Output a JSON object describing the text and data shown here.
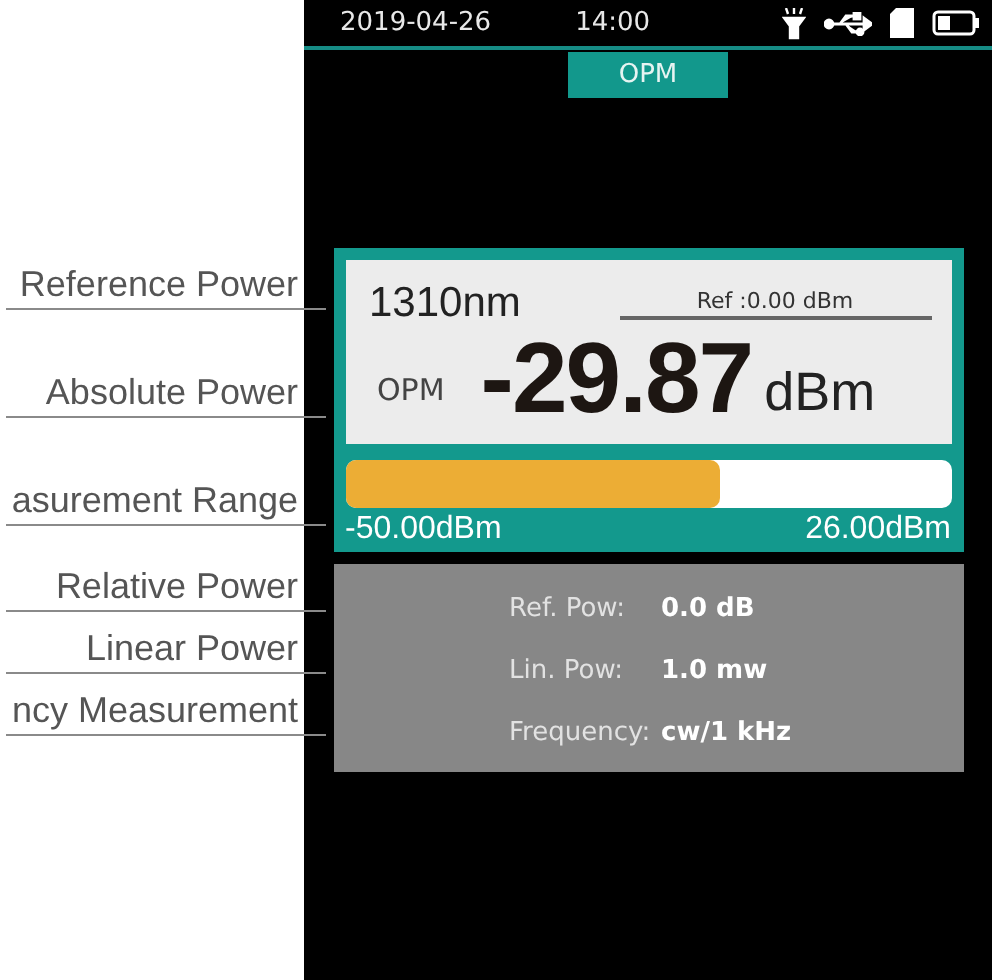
{
  "callouts": [
    {
      "label": "Reference Power"
    },
    {
      "label": "Absolute Power"
    },
    {
      "label": "asurement Range"
    },
    {
      "label": "Relative Power"
    },
    {
      "label": "Linear Power"
    },
    {
      "label": "ncy Measurement"
    }
  ],
  "status_bar": {
    "date": "2019-04-26",
    "time": "14:00"
  },
  "tabs": [
    {
      "label": "OPM",
      "selected": true
    }
  ],
  "meter": {
    "wavelength": "1310nm",
    "reference": "Ref :0.00  dBm",
    "mode": "OPM",
    "value": "-29.87",
    "unit": "dBm",
    "level": 0.62,
    "range_min": "-50.00dBm",
    "range_max": "26.00dBm"
  },
  "readings": [
    {
      "label": "Ref. Pow:",
      "value": "0.0 dB"
    },
    {
      "label": "Lin. Pow:",
      "value": "1.0 mw"
    },
    {
      "label": "Frequency:",
      "value": "cw/1 kHz"
    }
  ]
}
